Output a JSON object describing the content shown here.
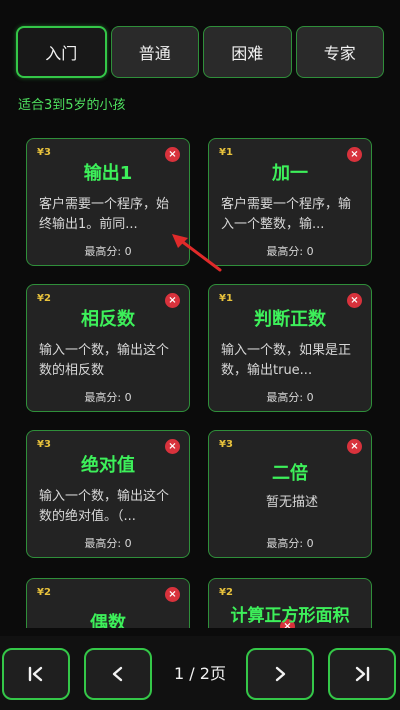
{
  "tabs": [
    {
      "label": "入门",
      "active": true
    },
    {
      "label": "普通",
      "active": false
    },
    {
      "label": "困难",
      "active": false
    },
    {
      "label": "专家",
      "active": false
    }
  ],
  "subtitle": "适合3到5岁的小孩",
  "price_symbol": "¥",
  "close_symbol": "×",
  "score_label": "最高分: 0",
  "cards": [
    {
      "price": "3",
      "title": "输出1",
      "desc": "客户需要一个程序，始终输出1。前同..."
    },
    {
      "price": "1",
      "title": "加一",
      "desc": "客户需要一个程序，输入一个整数，输..."
    },
    {
      "price": "2",
      "title": "相反数",
      "desc": "输入一个数，输出这个数的相反数"
    },
    {
      "price": "1",
      "title": "判断正数",
      "desc": "输入一个数，如果是正数，输出true..."
    },
    {
      "price": "3",
      "title": "绝对值",
      "desc": "输入一个数，输出这个数的绝对值。（..."
    },
    {
      "price": "3",
      "title": "二倍",
      "desc": "暂无描述"
    },
    {
      "price": "2",
      "title": "偶数",
      "desc": ""
    },
    {
      "price": "2",
      "title": "计算正方形面积",
      "desc": ""
    }
  ],
  "pagination": {
    "indicator": "1 / 2页",
    "first_icon": "first-page-icon",
    "prev_icon": "chevron-left-icon",
    "next_icon": "chevron-right-icon",
    "last_icon": "last-page-icon"
  },
  "colors": {
    "accent": "#34c748",
    "title": "#3df05a",
    "price": "#e8c23c",
    "close": "#d8323c"
  }
}
